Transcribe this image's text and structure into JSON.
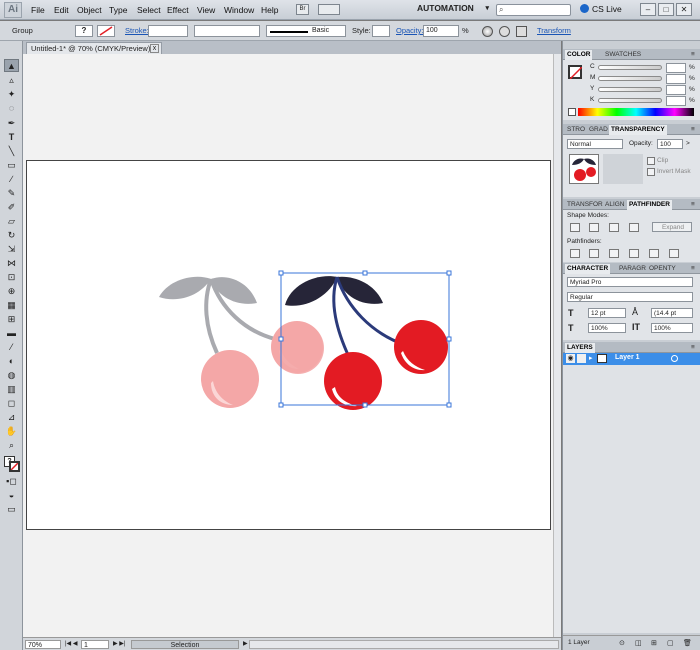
{
  "app": {
    "logo": "Ai"
  },
  "menu": [
    "File",
    "Edit",
    "Object",
    "Type",
    "Select",
    "Effect",
    "View",
    "Window",
    "Help"
  ],
  "workspace": "AUTOMATION",
  "cslive": "CS Live",
  "window_buttons": [
    "–",
    "□",
    "✕"
  ],
  "control": {
    "selection_label": "Group",
    "stroke_label": "Stroke:",
    "brush_label": "Basic",
    "style_label": "Style:",
    "opacity_label": "Opacity:",
    "opacity_value": "100",
    "percent": "%",
    "transform_label": "Transform"
  },
  "document": {
    "tab_title": "Untitled-1* @ 70% (CMYK/Preview)",
    "close": "x"
  },
  "status": {
    "zoom": "70%",
    "page": "1",
    "tool": "Selection"
  },
  "color_panel": {
    "tabs": [
      "COLOR",
      "SWATCHES"
    ],
    "channels": [
      "C",
      "M",
      "Y",
      "K"
    ],
    "unit": "%"
  },
  "transparency_panel": {
    "tabs": [
      "STRO",
      "GRAD",
      "TRANSPARENCY"
    ],
    "blend_mode": "Normal",
    "opacity_label": "Opacity:",
    "opacity_value": "100",
    "opacity_unit": ">",
    "clip_label": "Clip",
    "invert_label": "Invert Mask"
  },
  "pathfinder_panel": {
    "tabs": [
      "TRANSFOR",
      "ALIGN",
      "PATHFINDER"
    ],
    "shape_modes_label": "Shape Modes:",
    "expand_label": "Expand",
    "pathfinders_label": "Pathfinders:"
  },
  "character_panel": {
    "tabs": [
      "CHARACTER",
      "PARAGR",
      "OPENTY"
    ],
    "font": "Myriad Pro",
    "style": "Regular",
    "size": "12 pt",
    "leading": "(14.4 pt",
    "hscale": "100%",
    "vscale": "100%"
  },
  "layers_panel": {
    "tab": "LAYERS",
    "layer_name": "Layer 1",
    "footer": "1 Layer"
  },
  "colors": {
    "menubar": "#d4d9df",
    "cherry_faded_leaf": "#a9aaaf",
    "cherry_faded_fruit": "#f4a7a7",
    "cherry_leaf": "#262538",
    "cherry_fruit": "#e31b23",
    "selection": "#3a75d8"
  }
}
